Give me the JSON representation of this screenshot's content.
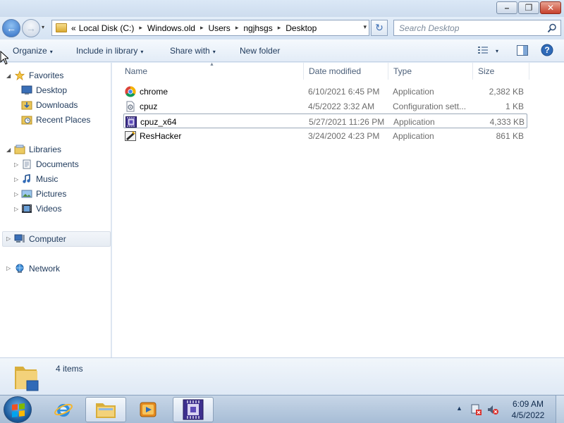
{
  "window": {
    "minimize_glyph": "–",
    "maximize_glyph": "❐",
    "close_glyph": "✕"
  },
  "nav": {
    "back_glyph": "←",
    "forward_glyph": "→",
    "history_glyph": "▾"
  },
  "address": {
    "overflow": "«",
    "crumbs": [
      "Local Disk (C:)",
      "Windows.old",
      "Users",
      "ngjhsgs",
      "Desktop"
    ],
    "separator": "▸",
    "dropdown_glyph": "▾",
    "refresh_glyph": "↻"
  },
  "search": {
    "placeholder": "Search Desktop"
  },
  "toolbar": {
    "organize": "Organize",
    "include_in_library": "Include in library",
    "share_with": "Share with",
    "new_folder": "New folder",
    "arrow": "▾",
    "help_glyph": "?"
  },
  "sidebar": {
    "favorites": {
      "label": "Favorites",
      "items": [
        {
          "label": "Desktop",
          "icon": "desktop-icon"
        },
        {
          "label": "Downloads",
          "icon": "downloads-icon"
        },
        {
          "label": "Recent Places",
          "icon": "recent-places-icon"
        }
      ]
    },
    "libraries": {
      "label": "Libraries",
      "items": [
        {
          "label": "Documents",
          "icon": "documents-icon"
        },
        {
          "label": "Music",
          "icon": "music-icon"
        },
        {
          "label": "Pictures",
          "icon": "pictures-icon"
        },
        {
          "label": "Videos",
          "icon": "videos-icon"
        }
      ]
    },
    "computer": {
      "label": "Computer"
    },
    "network": {
      "label": "Network"
    },
    "expanded_glyph": "◢",
    "collapsed_glyph": "▷"
  },
  "files": {
    "columns": {
      "name": "Name",
      "date_modified": "Date modified",
      "type": "Type",
      "size": "Size"
    },
    "sort_glyph": "▲",
    "rows": [
      {
        "name": "chrome",
        "date": "6/10/2021 6:45 PM",
        "type": "Application",
        "size": "2,382 KB",
        "icon": "chrome-icon"
      },
      {
        "name": "cpuz",
        "date": "4/5/2022 3:32 AM",
        "type": "Configuration sett...",
        "size": "1 KB",
        "icon": "config-file-icon"
      },
      {
        "name": "cpuz_x64",
        "date": "5/27/2021 11:26 PM",
        "type": "Application",
        "size": "4,333 KB",
        "icon": "cpuz-icon",
        "selected": true
      },
      {
        "name": "ResHacker",
        "date": "3/24/2002 4:23 PM",
        "type": "Application",
        "size": "861 KB",
        "icon": "reshacker-icon"
      }
    ]
  },
  "details": {
    "count": "4 items"
  },
  "taskbar": {
    "pinned": [
      "internet-explorer-icon",
      "windows-explorer-icon",
      "media-player-icon",
      "cpuz-icon"
    ],
    "active": "windows-explorer-icon",
    "tray_arrow": "▲",
    "clock_time": "6:09 AM",
    "clock_date": "4/5/2022"
  }
}
